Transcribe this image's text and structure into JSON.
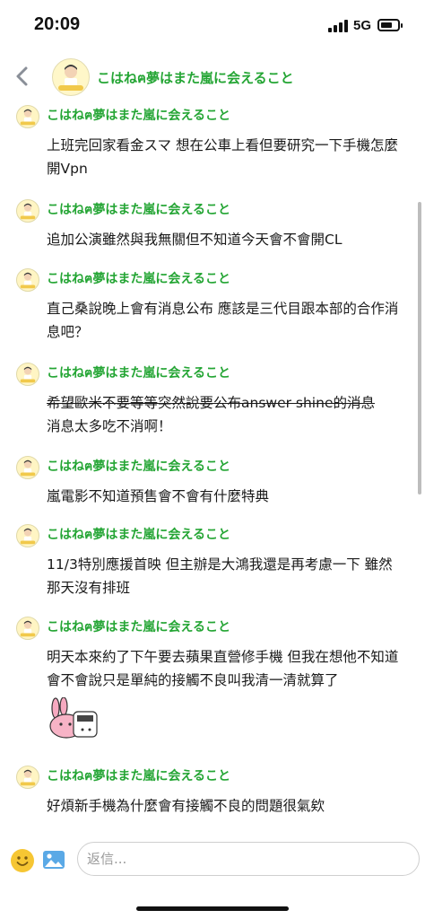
{
  "status_bar": {
    "time": "20:09",
    "network": "5G"
  },
  "header": {
    "title": "こはねฅ夢はまた嵐に会えること"
  },
  "messages": [
    {
      "sender": "こはねฅ夢はまた嵐に会えること",
      "text": "上班完回家看金スマ 想在公車上看但要研究一下手機怎麼開Vpn"
    },
    {
      "sender": "こはねฅ夢はまた嵐に会えること",
      "text": "追加公演雖然與我無關但不知道今天會不會開CL"
    },
    {
      "sender": "こはねฅ夢はまた嵐に会えること",
      "text": "直己桑說晚上會有消息公布 應該是三代目跟本部的合作消息吧？"
    },
    {
      "sender": "こはねฅ夢はまた嵐に会えること",
      "text_strike": "希望歐米不要等等突然說要公布answer shine的消息",
      "text": "消息太多吃不消啊！"
    },
    {
      "sender": "こはねฅ夢はまた嵐に会えること",
      "text": "嵐電影不知道預售會不會有什麼特典"
    },
    {
      "sender": "こはねฅ夢はまた嵐に会えること",
      "text": "11/3特別應援首映 但主辦是大鴻我還是再考慮一下 雖然那天沒有排班"
    },
    {
      "sender": "こはねฅ夢はまた嵐に会えること",
      "text": "明天本來約了下午要去蘋果直營修手機 但我在想他不知道會不會說只是單純的接觸不良叫我清一清就算了",
      "sticker": "rabbit-sticker"
    },
    {
      "sender": "こはねฅ夢はまた嵐に会えること",
      "text": "好煩新手機為什麼會有接觸不良的問題很氣欸"
    }
  ],
  "composer": {
    "placeholder": "返信..."
  },
  "colors": {
    "sender": "#24a534",
    "background": "#ffffff"
  },
  "icons": {
    "back": "chevron-left-icon",
    "emoji": "emoji-icon",
    "image": "image-icon"
  }
}
